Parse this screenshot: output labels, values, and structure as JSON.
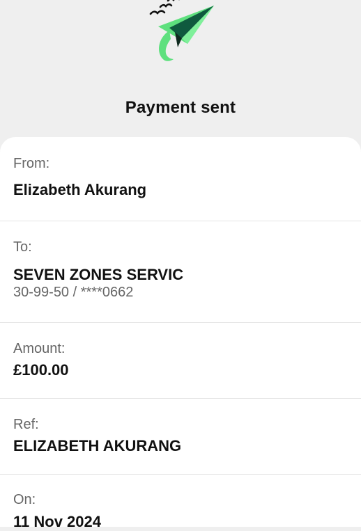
{
  "header": {
    "title": "Payment sent"
  },
  "details": {
    "from": {
      "label": "From:",
      "value": "Elizabeth Akurang"
    },
    "to": {
      "label": "To:",
      "value": "SEVEN ZONES SERVIC",
      "account": "30-99-50 / ****0662"
    },
    "amount": {
      "label": "Amount:",
      "value": "£100.00"
    },
    "ref": {
      "label": "Ref:",
      "value": "ELIZABETH AKURANG"
    },
    "on": {
      "label": "On:",
      "value": "11 Nov 2024"
    }
  },
  "colors": {
    "plane_light": "#5ee07e",
    "plane_dark": "#0f5a3e",
    "bird": "#111111",
    "background": "#efefef",
    "card": "#ffffff"
  },
  "icons": {
    "hero": "paper-plane-icon",
    "birds": "birds-icon"
  }
}
